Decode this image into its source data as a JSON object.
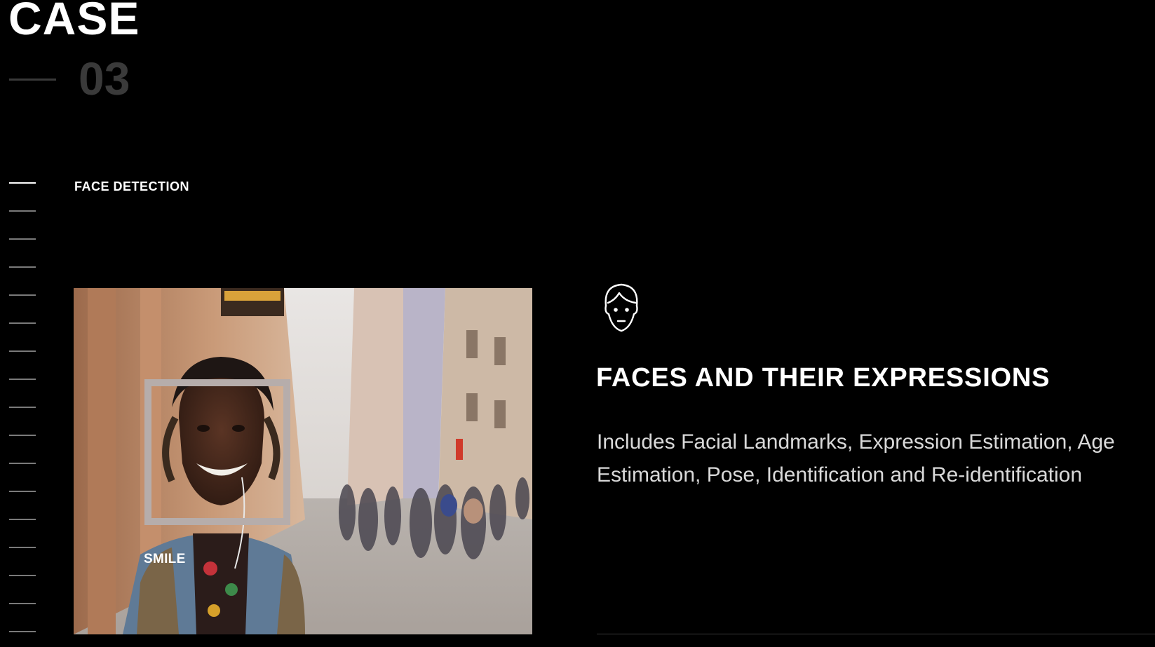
{
  "case": {
    "title": "CASE",
    "number": "03"
  },
  "section": {
    "label": "FACE DETECTION"
  },
  "photo": {
    "detection_label": "SMILE",
    "box_color": "#b6adab"
  },
  "feature": {
    "icon": "face-icon",
    "heading": "FACES AND THEIR EXPRESSIONS",
    "description": "Includes Facial Landmarks, Expression Estimation, Age Estimation, Pose, Identification and Re-identification"
  },
  "colors": {
    "background": "#000000",
    "text": "#ffffff",
    "muted": "#3a3a3a",
    "tick": "#7a7a7a"
  }
}
